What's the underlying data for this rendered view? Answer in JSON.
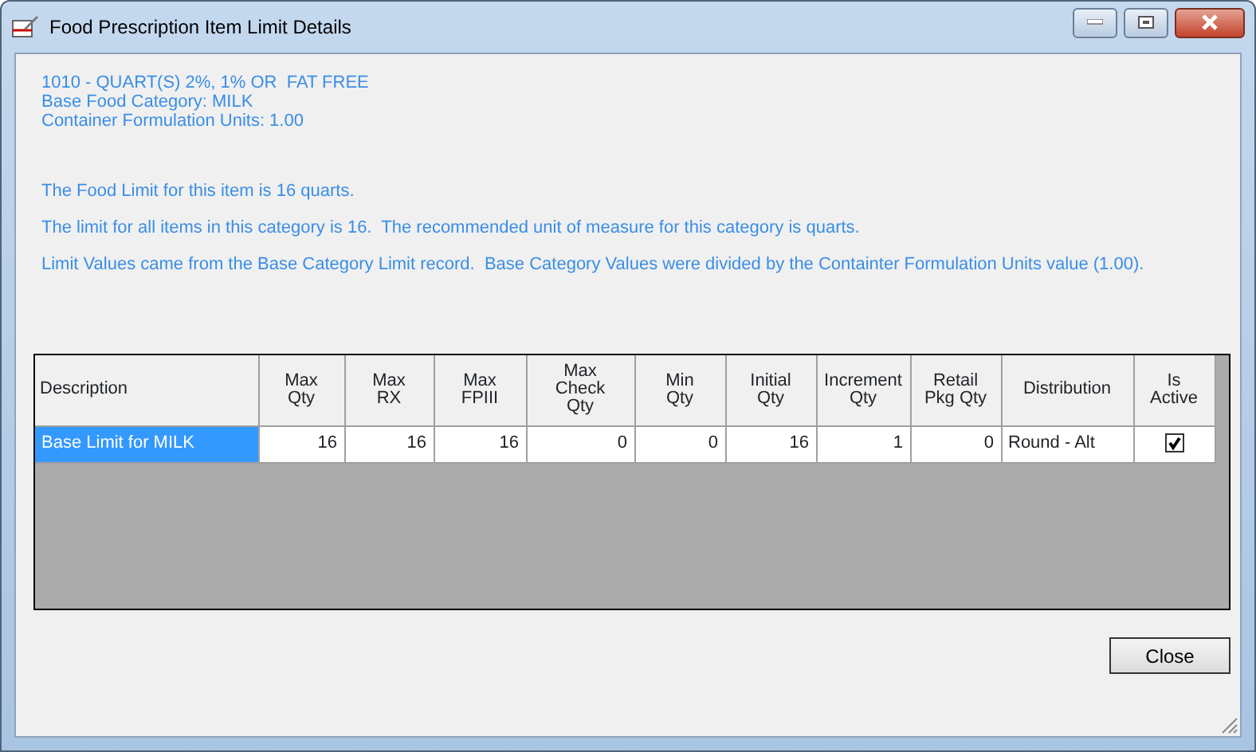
{
  "window": {
    "title": "Food Prescription Item Limit Details"
  },
  "header_lines": [
    "1010 - QUART(S) 2%, 1% OR  FAT FREE",
    "Base Food Category: MILK",
    "Container Formulation Units: 1.00"
  ],
  "messages": [
    "The Food Limit for this item is 16 quarts.",
    "The limit for all items in this category is 16.  The recommended unit of measure for this category is quarts.",
    "Limit Values came from the Base Category Limit record.  Base Category Values were divided by the Containter Formulation Units value (1.00)."
  ],
  "table": {
    "columns": [
      "Description",
      "Max\nQty",
      "Max\nRX",
      "Max\nFPIII",
      "Max\nCheck\nQty",
      "Min\nQty",
      "Initial\nQty",
      "Increment\nQty",
      "Retail\nPkg Qty",
      "Distribution",
      "Is\nActive"
    ],
    "rows": [
      {
        "selected": true,
        "description": "Base Limit for MILK",
        "max_qty": "16",
        "max_rx": "16",
        "max_fpiii": "16",
        "max_check_qty": "0",
        "min_qty": "0",
        "initial_qty": "16",
        "increment_qty": "1",
        "retail_pkg_qty": "0",
        "distribution": "Round - Alt",
        "is_active": true
      }
    ]
  },
  "buttons": [
    "Close"
  ]
}
